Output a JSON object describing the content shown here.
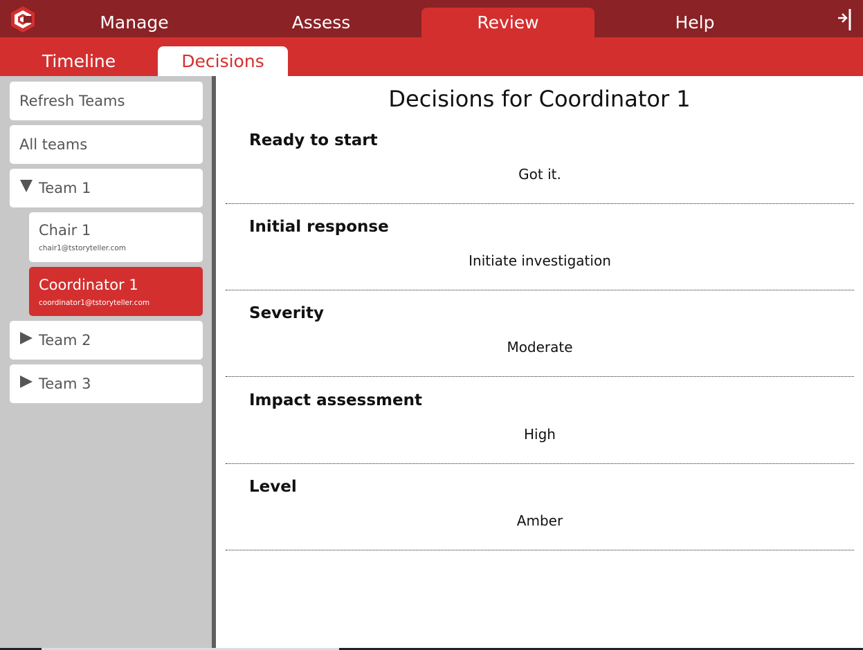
{
  "colors": {
    "top_bar": "#8a2226",
    "accent": "#d32f2f",
    "sidebar": "#c8c8c8"
  },
  "nav": {
    "logo_icon": "app-logo-icon",
    "tabs": [
      {
        "label": "Manage"
      },
      {
        "label": "Assess"
      },
      {
        "label": "Review",
        "active": true
      },
      {
        "label": "Help"
      }
    ],
    "logout_icon": "logout-icon"
  },
  "subnav": {
    "tabs": [
      {
        "label": "Timeline"
      },
      {
        "label": "Decisions",
        "active": true
      }
    ]
  },
  "sidebar": {
    "refresh_label": "Refresh Teams",
    "all_teams_label": "All teams",
    "teams": [
      {
        "label": "Team 1",
        "expanded": true,
        "members": [
          {
            "name": "Chair 1",
            "email": "chair1@tstoryteller.com"
          },
          {
            "name": "Coordinator 1",
            "email": "coordinator1@tstoryteller.com",
            "selected": true
          }
        ]
      },
      {
        "label": "Team 2",
        "expanded": false
      },
      {
        "label": "Team 3",
        "expanded": false
      }
    ]
  },
  "main": {
    "title": "Decisions for Coordinator 1",
    "decisions": [
      {
        "question": "Ready to start",
        "answer": "Got it."
      },
      {
        "question": "Initial response",
        "answer": "Initiate investigation"
      },
      {
        "question": "Severity",
        "answer": "Moderate"
      },
      {
        "question": "Impact assessment",
        "answer": "High"
      },
      {
        "question": "Level",
        "answer": "Amber"
      }
    ]
  }
}
